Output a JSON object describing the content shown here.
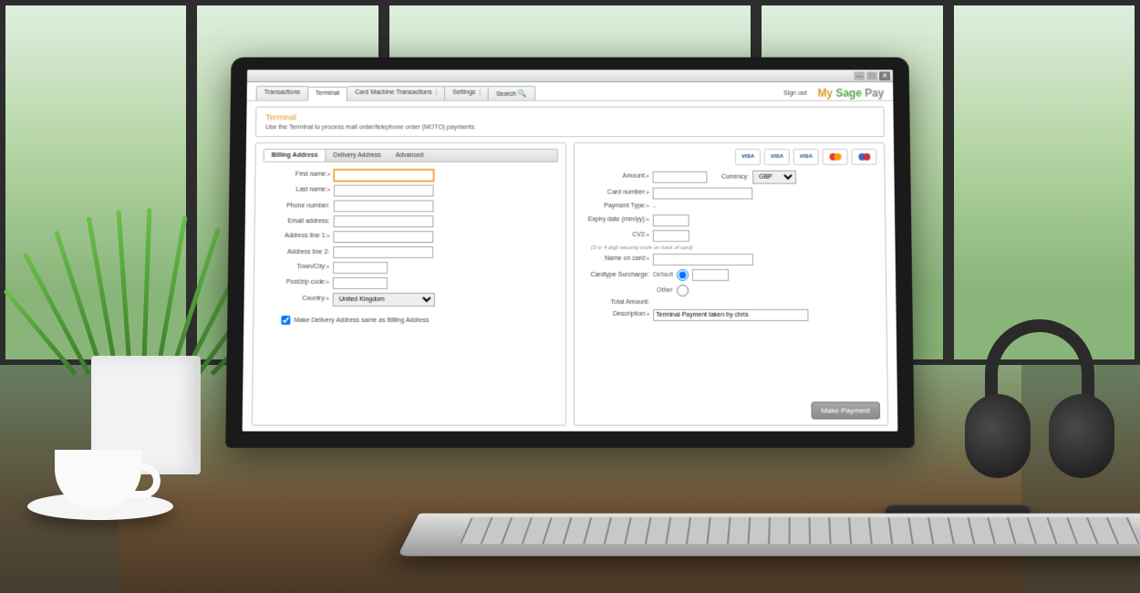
{
  "window": {
    "minimize": "—",
    "maximize": "□",
    "close": "✕"
  },
  "nav": {
    "tabs": [
      "Transactions",
      "Terminal",
      "Card Machine Transactions",
      "Settings",
      "Search"
    ],
    "active": "Terminal",
    "signout": "Sign out",
    "brand_my": "My",
    "brand_sage": " Sage",
    "brand_pay": " Pay"
  },
  "header": {
    "title": "Terminal",
    "subtitle": "Use the Terminal to process mail order/telephone order (MOTO) payments."
  },
  "billing": {
    "tabs": [
      "Billing Address",
      "Delivery Address",
      "Advanced"
    ],
    "active": "Billing Address",
    "first_name": {
      "label": "First name:",
      "value": ""
    },
    "last_name": {
      "label": "Last name:",
      "value": ""
    },
    "phone": {
      "label": "Phone number:",
      "value": ""
    },
    "email": {
      "label": "Email address:",
      "value": ""
    },
    "address1": {
      "label": "Address line 1:",
      "value": ""
    },
    "address2": {
      "label": "Address line 2:",
      "value": ""
    },
    "city": {
      "label": "Town/City:",
      "value": ""
    },
    "postcode": {
      "label": "Post/zip code:",
      "value": ""
    },
    "country": {
      "label": "Country:",
      "value": "United Kingdom"
    },
    "same_as_billing": {
      "label": "Make Delivery Address same as Billing Address",
      "checked": true
    }
  },
  "payment": {
    "cards": [
      "VISA",
      "VISA",
      "VISA",
      "mastercard",
      "maestro"
    ],
    "amount": {
      "label": "Amount:",
      "value": ""
    },
    "currency": {
      "label": "Currency:",
      "value": "GBP"
    },
    "card_number": {
      "label": "Card number:",
      "value": ""
    },
    "payment_type": {
      "label": "Payment Type:",
      "value": ""
    },
    "expiry": {
      "label": "Expiry date (mm/yy):",
      "value": ""
    },
    "cv2": {
      "label": "CV2:",
      "value": ""
    },
    "cv2_hint": "(3 or 4 digit security code on back of card)",
    "name_on_card": {
      "label": "Name on card:",
      "value": ""
    },
    "surcharge": {
      "label": "Cardtype Surcharge:",
      "default_label": "Default",
      "other_label": "Other",
      "selected": "default",
      "value": ""
    },
    "total": {
      "label": "Total Amount:",
      "value": ""
    },
    "description": {
      "label": "Description:",
      "value": "Terminal Payment taken by chris"
    },
    "submit": "Make Payment"
  }
}
